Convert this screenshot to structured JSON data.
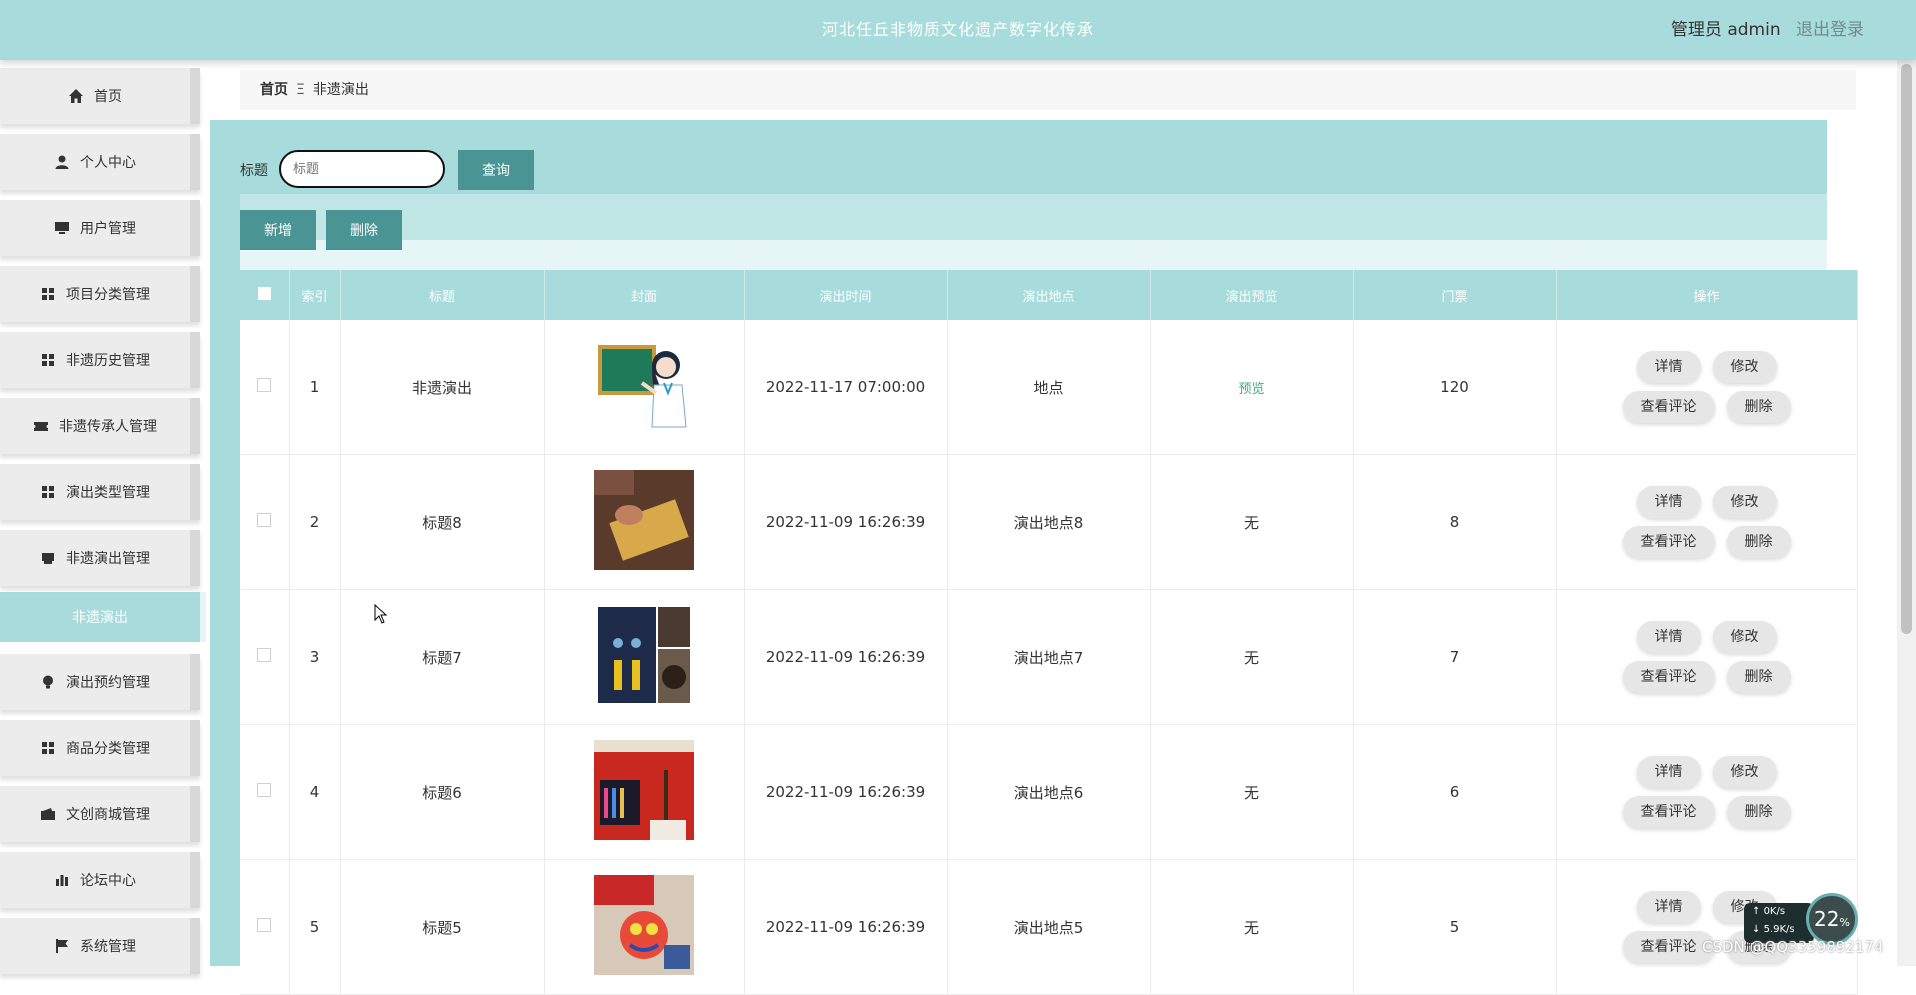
{
  "header": {
    "title": "河北任丘非物质文化遗产数字化传承",
    "user_label": "管理员 admin",
    "logout_label": "退出登录"
  },
  "sidebar": {
    "items": [
      {
        "label": "首页",
        "icon": "home-icon"
      },
      {
        "label": "个人中心",
        "icon": "user-icon"
      },
      {
        "label": "用户管理",
        "icon": "monitor-icon"
      },
      {
        "label": "项目分类管理",
        "icon": "grid-icon"
      },
      {
        "label": "非遗历史管理",
        "icon": "grid-icon"
      },
      {
        "label": "非遗传承人管理",
        "icon": "ticket-icon"
      },
      {
        "label": "演出类型管理",
        "icon": "grid-icon"
      },
      {
        "label": "非遗演出管理",
        "icon": "printer-icon"
      },
      {
        "label": "演出预约管理",
        "icon": "bulb-icon"
      },
      {
        "label": "商品分类管理",
        "icon": "grid-icon"
      },
      {
        "label": "文创商城管理",
        "icon": "wallet-icon"
      },
      {
        "label": "论坛中心",
        "icon": "bar-chart-icon"
      },
      {
        "label": "系统管理",
        "icon": "flag-icon"
      }
    ],
    "sub_item": "非遗演出"
  },
  "breadcrumb": {
    "home": "首页",
    "separator": "Ξ",
    "current": "非遗演出"
  },
  "search": {
    "label": "标题",
    "placeholder": "标题",
    "query_button": "查询"
  },
  "actions": {
    "add": "新增",
    "delete": "删除"
  },
  "table": {
    "headers": [
      "索引",
      "标题",
      "封面",
      "演出时间",
      "演出地点",
      "演出预览",
      "门票",
      "操作"
    ],
    "rows": [
      {
        "index": "1",
        "title": "非遗演出",
        "time": "2022-11-17 07:00:00",
        "location": "地点",
        "preview": "预览",
        "preview_is_link": true,
        "ticket": "120",
        "cover": "teacher-cartoon"
      },
      {
        "index": "2",
        "title": "标题8",
        "time": "2022-11-09 16:26:39",
        "location": "演出地点8",
        "preview": "无",
        "preview_is_link": false,
        "ticket": "8",
        "cover": "craft-scroll"
      },
      {
        "index": "3",
        "title": "标题7",
        "time": "2022-11-09 16:26:39",
        "location": "演出地点7",
        "preview": "无",
        "preview_is_link": false,
        "ticket": "7",
        "cover": "tassel-ornaments"
      },
      {
        "index": "4",
        "title": "标题6",
        "time": "2022-11-09 16:26:39",
        "location": "演出地点6",
        "preview": "无",
        "preview_is_link": false,
        "ticket": "6",
        "cover": "exhibition-display"
      },
      {
        "index": "5",
        "title": "标题5",
        "time": "2022-11-09 16:26:39",
        "location": "演出地点5",
        "preview": "无",
        "preview_is_link": false,
        "ticket": "5",
        "cover": "lion-head-craft"
      }
    ],
    "row_buttons": {
      "detail": "详情",
      "edit": "修改",
      "comments": "查看评论",
      "delete": "删除"
    }
  },
  "overlay": {
    "upload": "0K/s",
    "download": "5.9K/s",
    "percent": "22",
    "percent_unit": "%"
  },
  "watermark": "CSDN @QQ3359892174",
  "colors": {
    "theme": "#a8dbdb",
    "button": "#4a9494",
    "link": "#3cb080"
  }
}
